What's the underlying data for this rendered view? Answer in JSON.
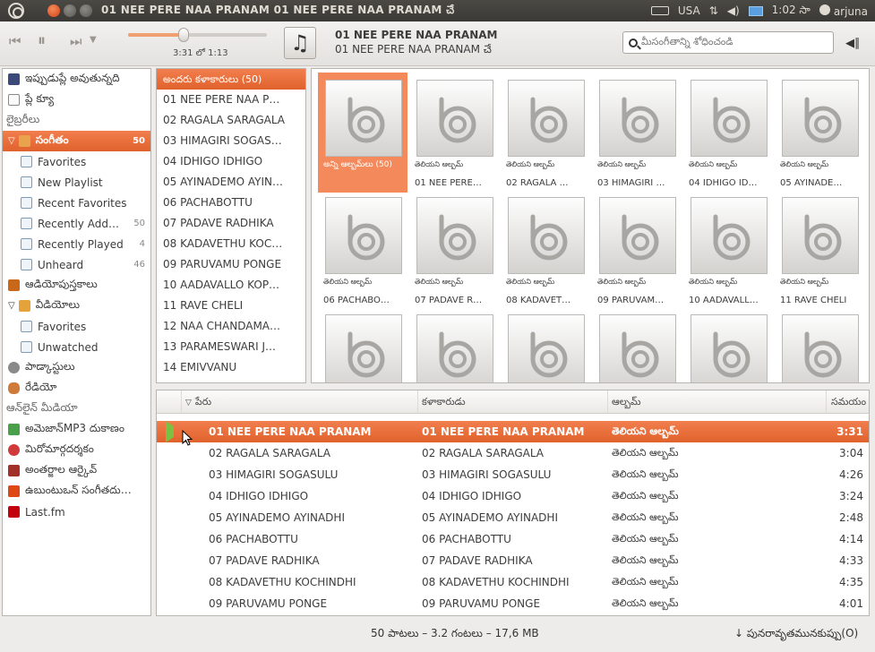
{
  "window": {
    "title": "01 NEE PERE NAA PRANAM 01 NEE PERE NAA PRANAM చే"
  },
  "tray": {
    "keyboard": "USA",
    "clock": "1:02 సా",
    "user": "arjuna"
  },
  "player": {
    "time": "3:31 లో 1:13",
    "now_playing_title": "01 NEE PERE NAA PRANAM",
    "now_playing_sub": "01 NEE PERE NAA PRANAM చే",
    "search_placeholder": "మీసంగీతాన్ని శోధించండి"
  },
  "sidebar": {
    "items": [
      {
        "label": "ఇప్పుడుప్లే అవుతున్నది",
        "icon": "now-playing-icon",
        "kind": "top"
      },
      {
        "label": "ప్లే క్యూ",
        "icon": "play-queue-icon",
        "kind": "top"
      },
      {
        "label": "లైబ్రరీలు",
        "kind": "section"
      },
      {
        "label": "సంగీతం",
        "icon": "music-icon",
        "kind": "selected",
        "count": "50"
      },
      {
        "label": "Favorites",
        "icon": "playlist-icon",
        "kind": "sub"
      },
      {
        "label": "New Playlist",
        "icon": "playlist-icon",
        "kind": "sub"
      },
      {
        "label": "Recent Favorites",
        "icon": "playlist-icon",
        "kind": "sub"
      },
      {
        "label": "Recently Add…",
        "icon": "playlist-icon",
        "kind": "sub",
        "count": "50"
      },
      {
        "label": "Recently Played",
        "icon": "playlist-icon",
        "kind": "sub",
        "count": "4"
      },
      {
        "label": "Unheard",
        "icon": "playlist-icon",
        "kind": "sub",
        "count": "46"
      },
      {
        "label": "ఆడియోపుస్తకాలు",
        "icon": "audiobook-icon",
        "kind": "top"
      },
      {
        "label": "వీడియోలు",
        "icon": "video-icon",
        "kind": "expand"
      },
      {
        "label": "Favorites",
        "icon": "playlist-icon",
        "kind": "sub"
      },
      {
        "label": "Unwatched",
        "icon": "playlist-icon",
        "kind": "sub"
      },
      {
        "label": "పాడ్కాస్టులు",
        "icon": "podcast-icon",
        "kind": "top"
      },
      {
        "label": "రేడియో",
        "icon": "radio-icon",
        "kind": "top"
      },
      {
        "label": "ఆన్‌లైన్ మీడియా",
        "kind": "section"
      },
      {
        "label": "అమెజాన్MP3 దుకాణం",
        "icon": "amazon-icon",
        "kind": "top"
      },
      {
        "label": "మిరోమార్గదర్శకం",
        "icon": "miro-icon",
        "kind": "top"
      },
      {
        "label": "అంతర్జాల ఆర్కైవ్",
        "icon": "archive-icon",
        "kind": "top"
      },
      {
        "label": "ఉబుంటుఒన్ సంగీతదు…",
        "icon": "ubuntu-one-icon",
        "kind": "top"
      },
      {
        "label": "Last.fm",
        "icon": "lastfm-icon",
        "kind": "top"
      }
    ]
  },
  "artists": {
    "header": "అందరు కళాకారులు (50)",
    "items": [
      "01 NEE PERE NAA P…",
      "02 RAGALA SARAGALA",
      "03 HIMAGIRI SOGAS…",
      "04 IDHIGO IDHIGO",
      "05 AYINADEMO AYIN…",
      "06 PACHABOTTU",
      "07 PADAVE RADHIKA",
      "08 KADAVETHU KOC…",
      "09 PARUVAMU PONGE",
      "10 AADAVALLO KOP…",
      "11 RAVE CHELI",
      "12 NAA CHANDAMA…",
      "13 PARAMESWARI J…",
      "14 EMIVVANU"
    ]
  },
  "albums": {
    "all_label": "అన్ని ఆల్బమ్‌లు (50)",
    "unknown_label": "తెలియని ఆల్బమ్",
    "items": [
      "",
      "01 NEE PERE…",
      "02 RAGALA …",
      "03 HIMAGIRI …",
      "04 IDHIGO ID…",
      "05 AYINADE…",
      "06 PACHABO…",
      "07 PADAVE R…",
      "08 KADAVET…",
      "09 PARUVAM…",
      "10 AADAVALL…",
      "11 RAVE CHELI"
    ]
  },
  "tracks": {
    "columns": {
      "name": "పేరు",
      "artist": "కళాకారుడు",
      "album": "ఆల్బమ్",
      "time": "సమయం"
    },
    "rows": [
      {
        "name": "01 NEE PERE NAA PRANAM",
        "artist": "01 NEE PERE NAA PRANAM",
        "album": "తెలియని ఆల్బమ్",
        "time": "3:31"
      },
      {
        "name": "02 RAGALA SARAGALA",
        "artist": "02 RAGALA SARAGALA",
        "album": "తెలియని ఆల్బమ్",
        "time": "3:04"
      },
      {
        "name": "03 HIMAGIRI SOGASULU",
        "artist": "03 HIMAGIRI SOGASULU",
        "album": "తెలియని ఆల్బమ్",
        "time": "4:26"
      },
      {
        "name": "04 IDHIGO IDHIGO",
        "artist": "04 IDHIGO IDHIGO",
        "album": "తెలియని ఆల్బమ్",
        "time": "3:24"
      },
      {
        "name": "05 AYINADEMO AYINADHI",
        "artist": "05 AYINADEMO AYINADHI",
        "album": "తెలియని ఆల్బమ్",
        "time": "2:48"
      },
      {
        "name": "06 PACHABOTTU",
        "artist": "06 PACHABOTTU",
        "album": "తెలియని ఆల్బమ్",
        "time": "4:14"
      },
      {
        "name": "07 PADAVE RADHIKA",
        "artist": "07 PADAVE RADHIKA",
        "album": "తెలియని ఆల్బమ్",
        "time": "4:33"
      },
      {
        "name": "08 KADAVETHU KOCHINDHI",
        "artist": "08 KADAVETHU KOCHINDHI",
        "album": "తెలియని ఆల్బమ్",
        "time": "4:35"
      },
      {
        "name": "09 PARUVAMU PONGE",
        "artist": "09 PARUVAMU PONGE",
        "album": "తెలియని ఆల్బమ్",
        "time": "4:01"
      }
    ]
  },
  "status": {
    "summary": "50 పాటలు – 3.2 గంటలు – 17,6 MB",
    "repeat": "పునరావృతమునకుప్పు(O)"
  },
  "colors": {
    "accent": "#e86a36",
    "panel": "#3a3935"
  }
}
